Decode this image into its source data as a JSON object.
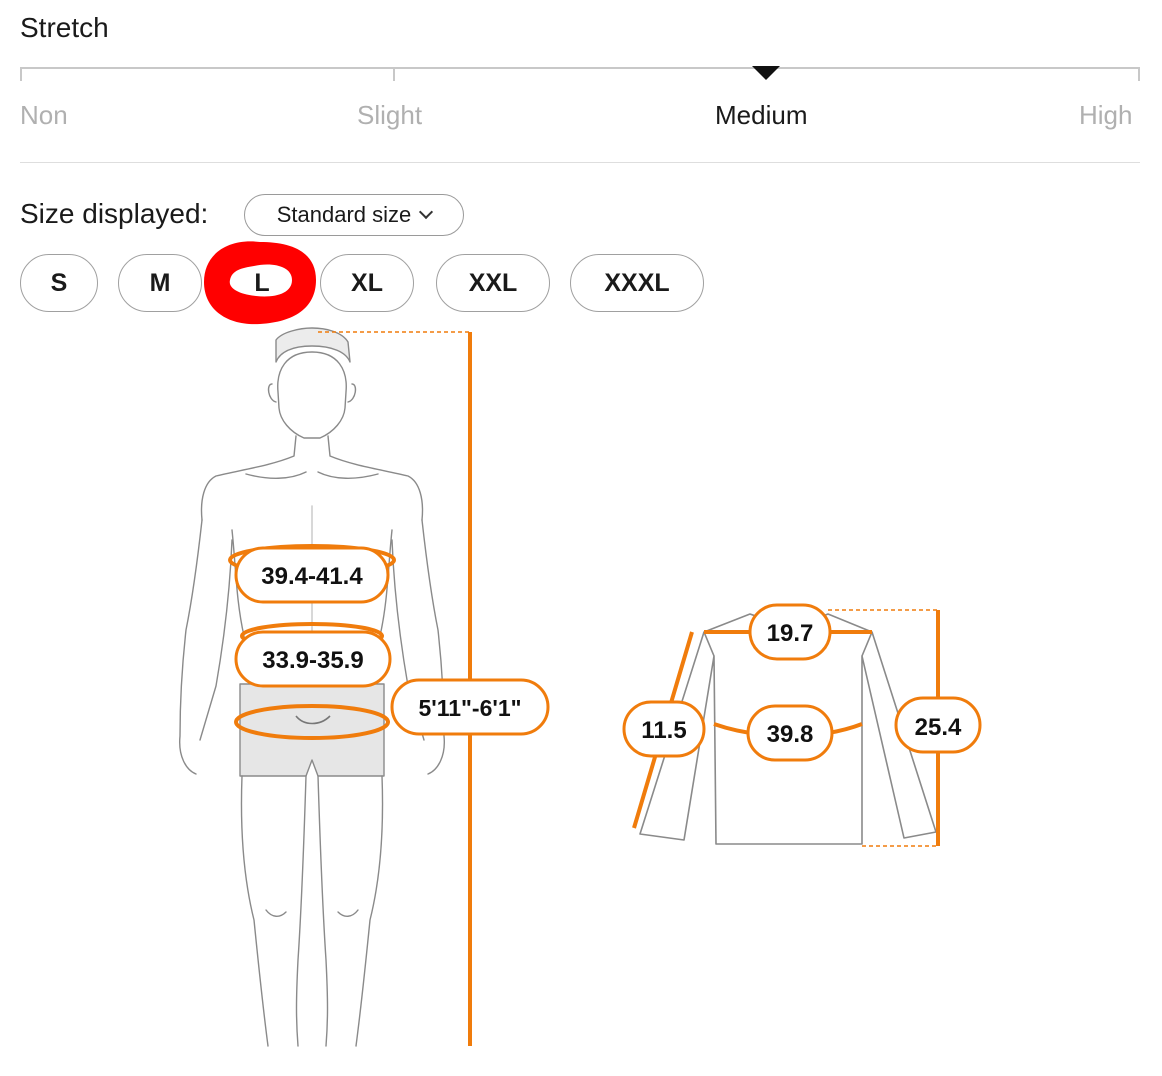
{
  "stretch": {
    "title": "Stretch",
    "levels": [
      "Non",
      "Slight",
      "Medium",
      "High"
    ],
    "selected": "Medium"
  },
  "size_display": {
    "label": "Size displayed:",
    "dropdown_value": "Standard size"
  },
  "sizes": [
    "S",
    "M",
    "L",
    "XL",
    "XXL",
    "XXXL"
  ],
  "selected_size": "L",
  "body_measurements": {
    "chest": "39.4-41.4",
    "waist": "33.9-35.9",
    "height": "5'11\"-6'1\""
  },
  "garment_measurements": {
    "shoulder": "19.7",
    "sleeve": "11.5",
    "chest": "39.8",
    "length": "25.4"
  },
  "colors": {
    "accent": "#f07c0c",
    "highlight": "#ff0000"
  }
}
